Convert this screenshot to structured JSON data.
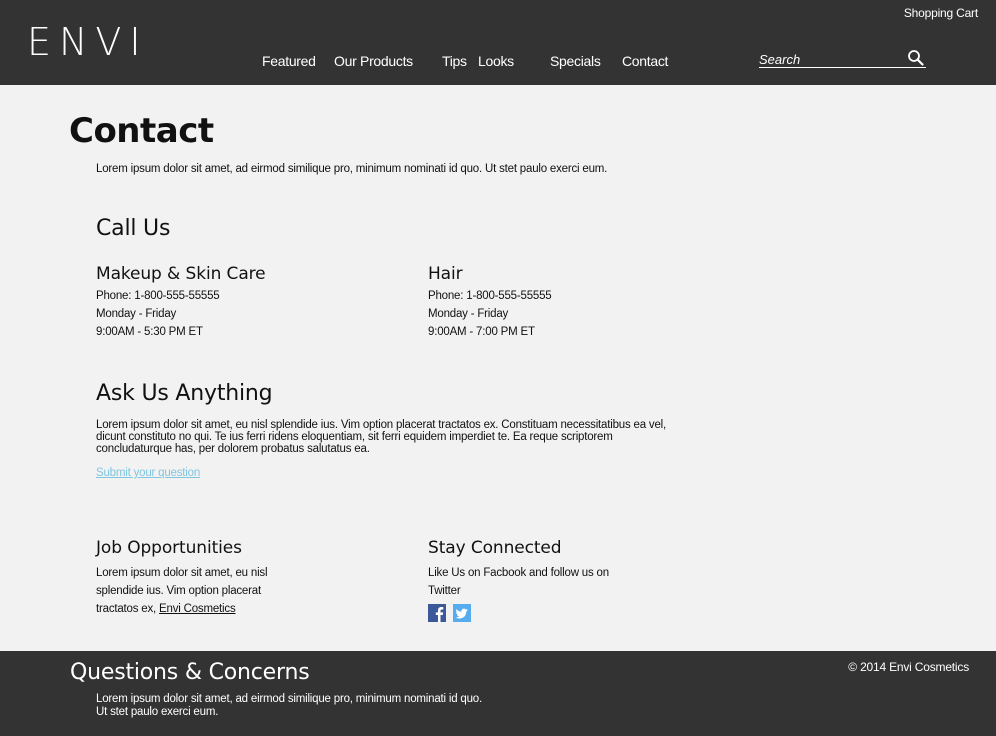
{
  "header": {
    "logo": "ENVI",
    "cart_label": "Shopping Cart",
    "nav": [
      "Featured",
      "Our Products",
      "Tips",
      "Looks",
      "Specials",
      "Contact"
    ],
    "search_placeholder": "Search",
    "search_icon": "magnifier-icon",
    "colors": {
      "bar": "#333333",
      "text": "#ffffff"
    }
  },
  "page": {
    "title": "Contact",
    "intro": "Lorem ipsum dolor sit amet, ad eirmod similique pro, minimum nominati id quo. Ut stet paulo exerci eum.",
    "call_us": {
      "heading": "Call Us",
      "makeup": {
        "heading": "Makeup & Skin Care",
        "phone": "Phone: 1-800-555-55555",
        "days": "Monday - Friday",
        "hours": "9:00AM - 5:30 PM ET"
      },
      "hair": {
        "heading": "Hair",
        "phone": "Phone: 1-800-555-55555",
        "days": "Monday - Friday",
        "hours": "9:00AM - 7:00 PM ET"
      }
    },
    "ask": {
      "heading": "Ask Us Anything",
      "body": "Lorem ipsum dolor sit amet, eu nisl splendide ius. Vim option placerat tractatos ex. Constituam necessitatibus ea vel, dicunt constituto no qui. Te ius ferri ridens eloquentiam, sit ferri equidem imperdiet te. Ea reque scriptorem concludaturque has, per dolorem probatus salutatus ea.",
      "link": "Submit your question",
      "link_color": "#7fc6e0"
    },
    "jobs": {
      "heading": "Job Opportunities",
      "body": "Lorem ipsum dolor sit amet, eu nisl splendide ius. Vim option placerat tractatos ex,",
      "link": "Envi Cosmetics"
    },
    "social": {
      "heading": "Stay Connected",
      "body": "Like Us on Facbook and follow us on Twitter",
      "icons": [
        "facebook-icon",
        "twitter-icon"
      ],
      "colors": {
        "facebook": "#3b5998",
        "twitter": "#55acee"
      }
    }
  },
  "footer": {
    "title": "Questions & Concerns",
    "text": "Lorem ipsum dolor sit amet, ad eirmod similique pro, minimum nominati id quo. Ut stet paulo exerci eum.",
    "copyright": "© 2014 Envi Cosmetics"
  },
  "colors": {
    "page_bg": "#f2f2f2"
  }
}
